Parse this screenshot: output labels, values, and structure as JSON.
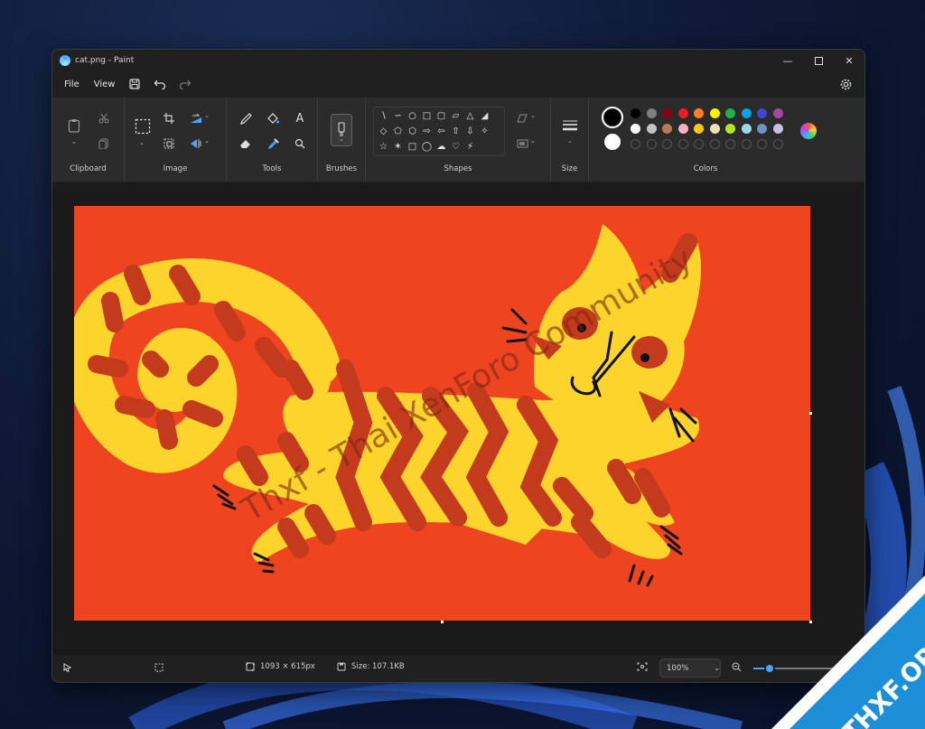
{
  "window": {
    "title": "cat.png - Paint"
  },
  "menu": {
    "file": "File",
    "view": "View"
  },
  "ribbon": {
    "groups": [
      "Clipboard",
      "Image",
      "Tools",
      "Brushes",
      "Shapes",
      "Size",
      "Colors"
    ]
  },
  "colors": {
    "primary": "#000000",
    "secondary": "#ffffff",
    "palette_row1": [
      "#000000",
      "#7f7f7f",
      "#880015",
      "#ed1c24",
      "#ff7f27",
      "#fff200",
      "#22b14c",
      "#00a2e8",
      "#3f48cc",
      "#a349a4"
    ],
    "palette_row2": [
      "#ffffff",
      "#c3c3c3",
      "#b97a57",
      "#ffaec9",
      "#ffc90e",
      "#efe4b0",
      "#b5e61d",
      "#99d9ea",
      "#7092be",
      "#c8bfe7"
    ],
    "accent": "#4aa3ff"
  },
  "canvas": {
    "background_color": "#ee4420",
    "cat_color": "#fdd42b",
    "stripe_color": "#c33a1d",
    "watermark": "Thxf - Thai XenForo Community"
  },
  "statusbar": {
    "dimensions": "1093 × 615px",
    "size": "Size: 107.1KB",
    "zoom": "100%",
    "zoom_fraction": 0.15
  },
  "site_logo": "THXF.ORG"
}
